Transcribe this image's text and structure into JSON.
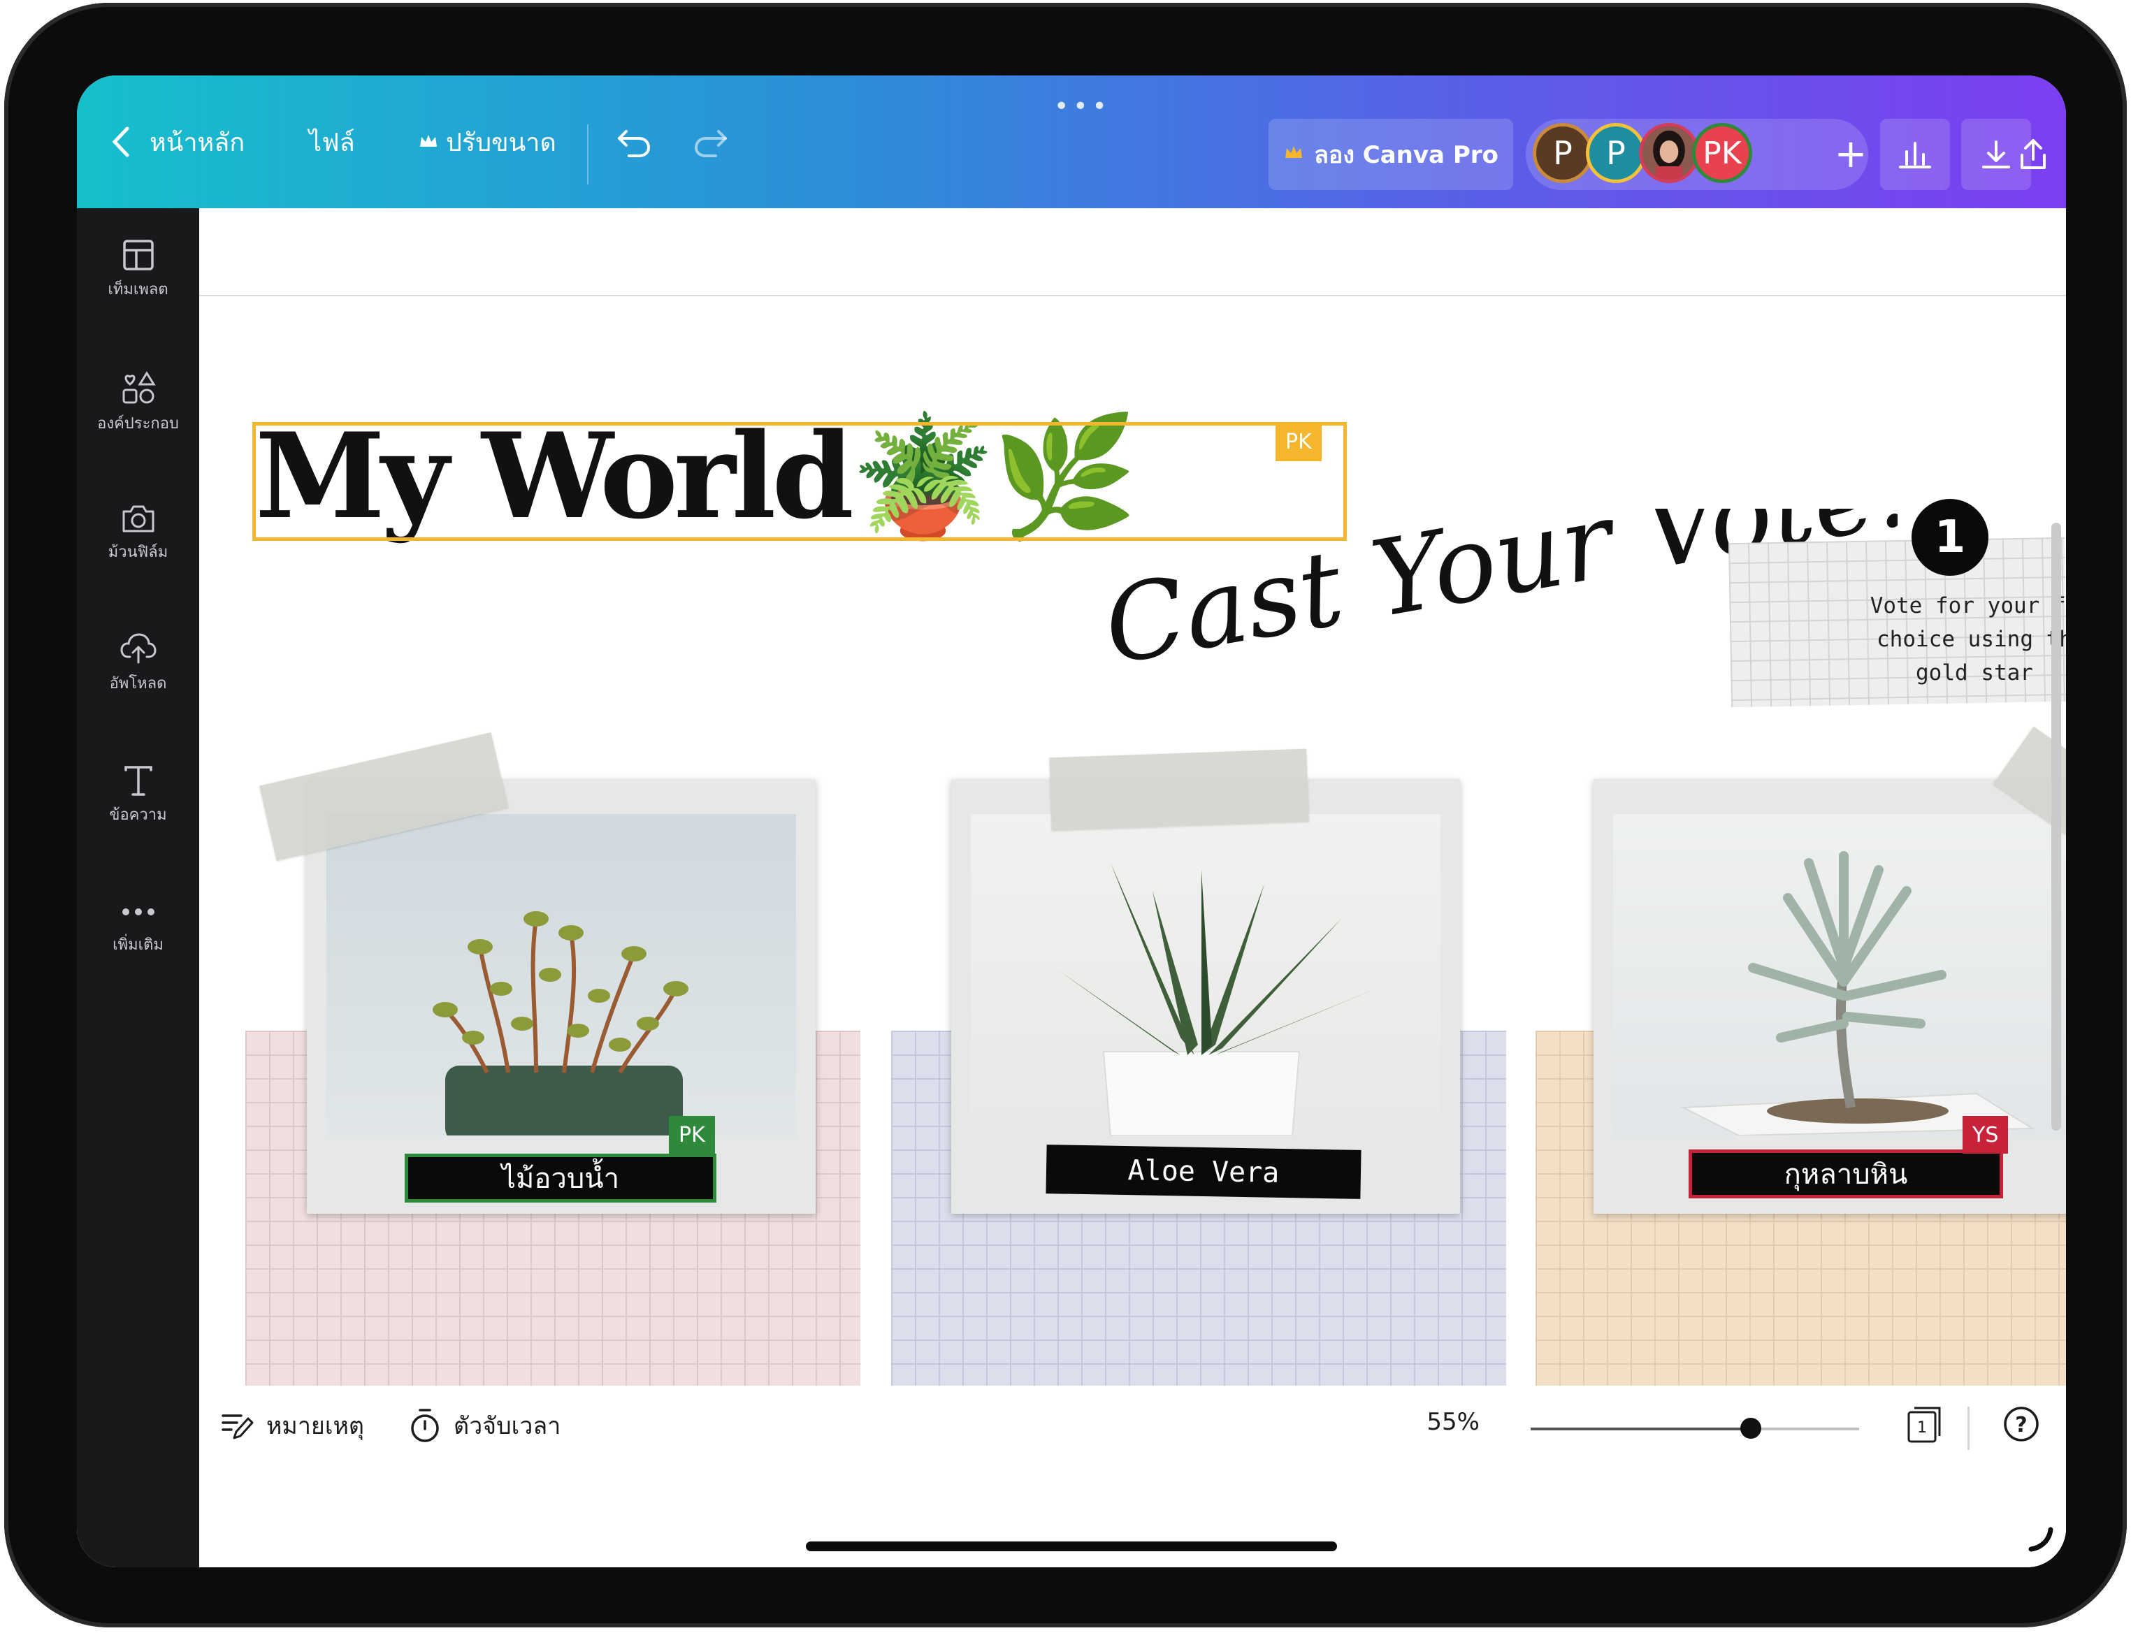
{
  "topbar": {
    "back_label": "หน้าหลัก",
    "file_label": "ไฟล์",
    "resize_label": "ปรับขนาด",
    "try_pro_label": "ลอง Canva Pro",
    "avatars": [
      {
        "initial": "P",
        "bg": "#5b3a24",
        "border": "#c98a3c"
      },
      {
        "initial": "P",
        "bg": "#1d8ea0",
        "border": "#f3c23a"
      },
      {
        "initial": "",
        "bg": "#6b3a34",
        "border": "#d33c5a"
      },
      {
        "initial": "PK",
        "bg": "#e8424f",
        "border": "#2e8a3a"
      }
    ],
    "add_label": "+"
  },
  "sidebar": {
    "items": [
      {
        "label": "เท็มเพลต",
        "icon": "template-icon"
      },
      {
        "label": "องค์ประกอบ",
        "icon": "elements-icon"
      },
      {
        "label": "ม้วนฟิล์ม",
        "icon": "camera-icon"
      },
      {
        "label": "อัพโหลด",
        "icon": "upload-icon"
      },
      {
        "label": "ข้อความ",
        "icon": "text-icon"
      },
      {
        "label": "เพิ่มเติม",
        "icon": "more-icon"
      }
    ]
  },
  "canvas": {
    "title": "My World🪴🌿",
    "title_badge": "PK",
    "script_text": "Cast Your Vote!",
    "vote_number": "1",
    "vote_text": "Vote for your fi\nchoice using th\ngold star",
    "cards": [
      {
        "label": "ไม้อวบน้ำ",
        "badge": "PK"
      },
      {
        "label": "Aloe Vera",
        "badge": ""
      },
      {
        "label": "กุหลาบหิน",
        "badge": "YS"
      }
    ]
  },
  "bottombar": {
    "notes_label": "หมายเหตุ",
    "timer_label": "ตัวจับเวลา",
    "zoom": "55%",
    "zoom_level": 0.55,
    "page_number": "1",
    "help": "?"
  },
  "colors": {
    "title_selection": "#f5b62e",
    "pk_green": "#2e8a3a",
    "ys_red": "#c8213a"
  }
}
